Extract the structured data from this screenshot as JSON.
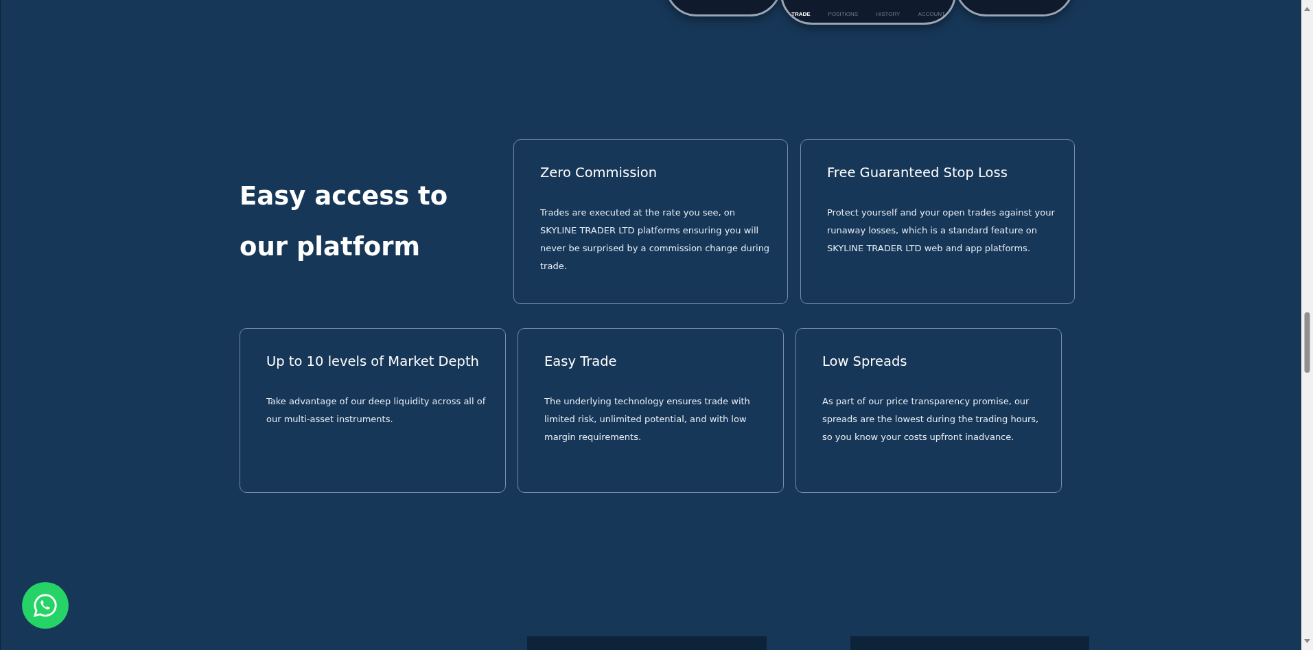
{
  "phone_tabs": [
    {
      "label": "TRADE",
      "selected": true
    },
    {
      "label": "POSITIONS",
      "selected": false
    },
    {
      "label": "HISTORY",
      "selected": false
    },
    {
      "label": "ACCOUNT",
      "selected": false
    }
  ],
  "heading": [
    "Easy access to",
    "our platform"
  ],
  "top_cards": [
    {
      "title": "Zero Commission",
      "text": "Trades are executed at the rate you see, on SKYLINE TRADER LTD platforms ensuring you will never be surprised by a commission change during trade."
    },
    {
      "title": "Free Guaranteed Stop Loss",
      "text": "Protect yourself and your open trades against your runaway losses, which is a standard feature on SKYLINE TRADER LTD web and app platforms."
    }
  ],
  "bottom_cards": [
    {
      "title": "Up to 10 levels of Market Depth",
      "text": "Take advantage of our deep liquidity across all of our multi-asset instruments."
    },
    {
      "title": "Easy Trade",
      "text": "The underlying technology ensures trade with limited risk, unlimited potential, and with low margin requirements."
    },
    {
      "title": "Low Spreads",
      "text": "As part of our price transparency promise, our spreads are the lowest during the trading hours, so you know your costs upfront inadvance."
    }
  ]
}
